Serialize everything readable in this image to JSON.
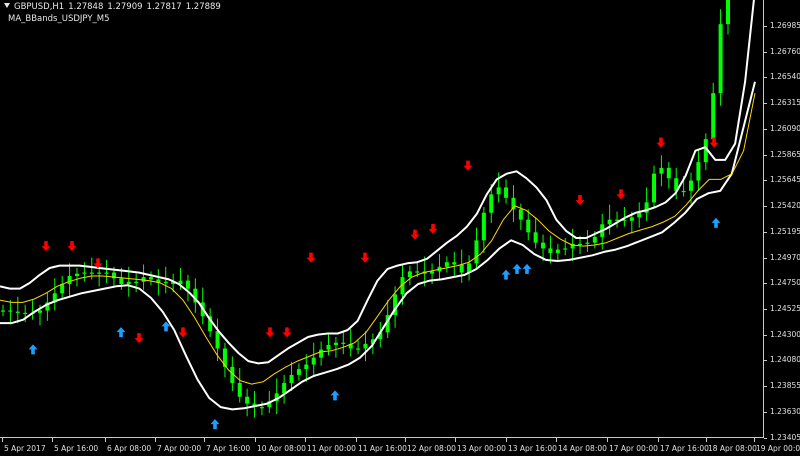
{
  "window": {
    "symbol_timeframe": "GBPUSD,H1",
    "open": "1.27848",
    "high": "1.27909",
    "low": "1.27817",
    "close": "1.27889",
    "indicator_name": "MA_BBands_USDJPY_M5"
  },
  "colors": {
    "background": "#000000",
    "candle": "#00ff00",
    "band": "#ffffff",
    "moving_average": "#ffd700",
    "sell_arrow": "#ff0000",
    "buy_arrow": "#1e9fff",
    "axis_text": "#e0e0e0"
  },
  "chart_data": {
    "type": "line",
    "title": "",
    "price_axis": {
      "ylim": [
        1.2341,
        1.2721
      ],
      "ticks": [
        "1.26985",
        "1.26760",
        "1.26540",
        "1.26315",
        "1.26090",
        "1.25865",
        "1.25645",
        "1.25420",
        "1.25195",
        "1.24970",
        "1.24750",
        "1.24525",
        "1.24300",
        "1.24080",
        "1.23855",
        "1.23630",
        "1.23405"
      ]
    },
    "time_axis": {
      "ticks": [
        "5 Apr 2017",
        "5 Apr 16:00",
        "6 Apr 08:00",
        "7 Apr 00:00",
        "7 Apr 16:00",
        "10 Apr 08:00",
        "11 Apr 00:00",
        "11 Apr 16:00",
        "12 Apr 08:00",
        "13 Apr 00:00",
        "13 Apr 16:00",
        "14 Apr 08:00",
        "17 Apr 00:00",
        "17 Apr 16:00",
        "18 Apr 08:00",
        "19 Apr 00:00"
      ]
    },
    "series": [
      {
        "name": "",
        "role": "close",
        "values": [
          1.2451,
          1.245,
          1.2449,
          1.2448,
          1.2449,
          1.2451,
          1.2458,
          1.2466,
          1.2474,
          1.2481,
          1.2483,
          1.2484,
          1.2483,
          1.2484,
          1.2484,
          1.2479,
          1.2474,
          1.2476,
          1.2476,
          1.248,
          1.2478,
          1.2475,
          1.2476,
          1.2474,
          1.2477,
          1.247,
          1.2458,
          1.2446,
          1.2433,
          1.2418,
          1.2402,
          1.2388,
          1.2376,
          1.237,
          1.2367,
          1.2367,
          1.2372,
          1.2379,
          1.2388,
          1.2395,
          1.24,
          1.2404,
          1.241,
          1.2417,
          1.2421,
          1.2423,
          1.2422,
          1.2418,
          1.2418,
          1.2422,
          1.2426,
          1.2432,
          1.2447,
          1.2465,
          1.248,
          1.2485,
          1.2485,
          1.2483,
          1.2485,
          1.2489,
          1.2493,
          1.2491,
          1.2484,
          1.2492,
          1.2512,
          1.2536,
          1.2552,
          1.2558,
          1.2549,
          1.2539,
          1.253,
          1.2519,
          1.251,
          1.2505,
          1.2501,
          1.2504,
          1.2505,
          1.2509,
          1.2509,
          1.251,
          1.2515,
          1.2526,
          1.253,
          1.253,
          1.2529,
          1.2532,
          1.2536,
          1.2545,
          1.257,
          1.2575,
          1.2566,
          1.2555,
          1.2555,
          1.2564,
          1.258,
          1.26,
          1.264,
          1.27,
          1.2725
        ]
      },
      {
        "name": "",
        "role": "upper_band",
        "values": [
          1.2472,
          1.247,
          1.247,
          1.2475,
          1.2482,
          1.2488,
          1.249,
          1.249,
          1.249,
          1.2489,
          1.2488,
          1.2487,
          1.2486,
          1.2485,
          1.2484,
          1.2482,
          1.248,
          1.2478,
          1.2474,
          1.2467,
          1.2458,
          1.2445,
          1.2433,
          1.2423,
          1.2414,
          1.2407,
          1.2405,
          1.2406,
          1.2412,
          1.2418,
          1.2423,
          1.2428,
          1.243,
          1.2431,
          1.2431,
          1.2434,
          1.2442,
          1.246,
          1.2477,
          1.2487,
          1.249,
          1.2492,
          1.2493,
          1.2496,
          1.2503,
          1.251,
          1.2516,
          1.2524,
          1.2535,
          1.2552,
          1.2565,
          1.257,
          1.2572,
          1.2566,
          1.2558,
          1.2547,
          1.253,
          1.252,
          1.2514,
          1.2514,
          1.2518,
          1.2522,
          1.2527,
          1.2532,
          1.2536,
          1.2538,
          1.2541,
          1.2545,
          1.2553,
          1.2568,
          1.259,
          1.2593,
          1.2582,
          1.2582,
          1.2596,
          1.265,
          1.273
        ]
      },
      {
        "name": "",
        "role": "middle_band",
        "values": [
          1.246,
          1.2458,
          1.2458,
          1.2461,
          1.2466,
          1.2472,
          1.2476,
          1.2479,
          1.2481,
          1.2481,
          1.248,
          1.2479,
          1.2478,
          1.2477,
          1.2475,
          1.247,
          1.246,
          1.2445,
          1.2428,
          1.2412,
          1.2399,
          1.239,
          1.2387,
          1.2389,
          1.2396,
          1.2402,
          1.2407,
          1.2411,
          1.2415,
          1.2416,
          1.2419,
          1.2423,
          1.2432,
          1.2446,
          1.246,
          1.2472,
          1.248,
          1.2484,
          1.2486,
          1.2488,
          1.249,
          1.2493,
          1.25,
          1.2512,
          1.253,
          1.2542,
          1.2538,
          1.253,
          1.252,
          1.2513,
          1.2508,
          1.2507,
          1.2508,
          1.251,
          1.2514,
          1.2518,
          1.2521,
          1.2524,
          1.2528,
          1.2533,
          1.2543,
          1.2555,
          1.2565,
          1.2565,
          1.257,
          1.259,
          1.264
        ]
      },
      {
        "name": "",
        "role": "lower_band",
        "values": [
          1.244,
          1.244,
          1.2443,
          1.245,
          1.2456,
          1.246,
          1.2463,
          1.2466,
          1.2468,
          1.247,
          1.2472,
          1.2473,
          1.247,
          1.2462,
          1.245,
          1.2434,
          1.2412,
          1.2391,
          1.2375,
          1.2367,
          1.2365,
          1.2366,
          1.2368,
          1.237,
          1.2375,
          1.2382,
          1.2389,
          1.2394,
          1.2397,
          1.24,
          1.2404,
          1.241,
          1.242,
          1.2436,
          1.2452,
          1.2466,
          1.2474,
          1.2477,
          1.2478,
          1.248,
          1.2482,
          1.2487,
          1.2495,
          1.2505,
          1.2512,
          1.2508,
          1.25,
          1.2495,
          1.2494,
          1.2495,
          1.2497,
          1.2499,
          1.2502,
          1.2504,
          1.2507,
          1.2511,
          1.2515,
          1.2519,
          1.2527,
          1.2536,
          1.2548,
          1.2553,
          1.2555,
          1.257,
          1.261,
          1.265
        ]
      }
    ],
    "signals": {
      "sell": [
        1.25,
        1.25,
        1.2485,
        1.242,
        1.2425,
        1.2425,
        1.2425,
        1.249,
        1.249,
        1.251,
        1.2515,
        1.257,
        1.254,
        1.2545,
        1.259,
        1.259
      ],
      "buy": [
        1.2425,
        1.244,
        1.2445,
        1.236,
        1.2385,
        1.249,
        1.2495,
        1.2495,
        1.2535
      ]
    }
  }
}
